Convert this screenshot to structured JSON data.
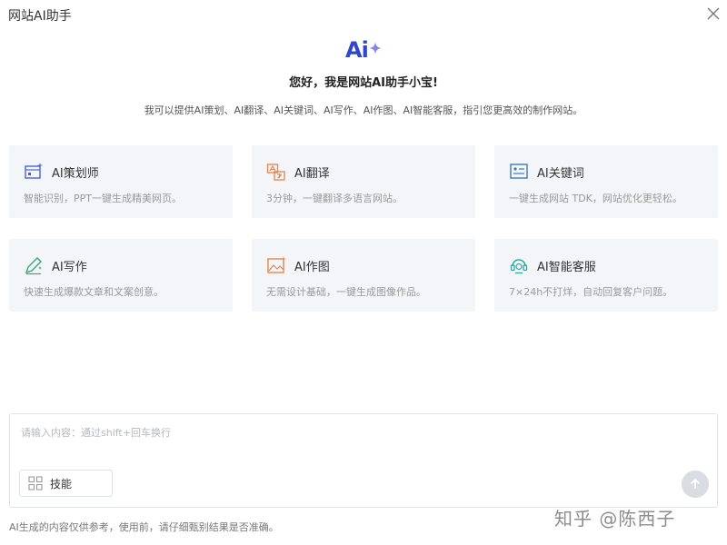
{
  "window": {
    "title": "网站AI助手"
  },
  "header": {
    "logo_text": "Ai",
    "greeting": "您好，我是网站AI助手小宝!",
    "intro": "我可以提供AI策划、AI翻译、AI关键词、AI写作、AI作图、AI智能客服，指引您更高效的制作网站。"
  },
  "features": [
    {
      "title": "AI策划师",
      "desc": "智能识别，PPT一键生成精美网页。",
      "icon": "planner-icon"
    },
    {
      "title": "AI翻译",
      "desc": "3分钟，一键翻译多语言网站。",
      "icon": "translate-icon"
    },
    {
      "title": "AI关键词",
      "desc": "一键生成网站 TDK，网站优化更轻松。",
      "icon": "keyword-icon"
    },
    {
      "title": "AI写作",
      "desc": "快速生成爆款文章和文案创意。",
      "icon": "writing-icon"
    },
    {
      "title": "AI作图",
      "desc": "无需设计基础，一键生成图像作品。",
      "icon": "image-icon"
    },
    {
      "title": "AI智能客服",
      "desc": "7×24h不打烊，自动回复客户问题。",
      "icon": "customer-service-icon"
    }
  ],
  "input": {
    "placeholder": "请输入内容：通过shift+回车换行",
    "value": "",
    "skill_label": "技能"
  },
  "footer": {
    "disclaimer": "AI生成的内容仅供参考，使用前，请仔细甄别结果是否准确。"
  },
  "watermark": {
    "text": "知乎 @陈西子"
  },
  "colors": {
    "accent": "#2f48c9",
    "icon_blue": "#4a63d4",
    "icon_orange": "#e8834a",
    "icon_green": "#3aa57a",
    "card_bg": "#f3f5f8"
  }
}
